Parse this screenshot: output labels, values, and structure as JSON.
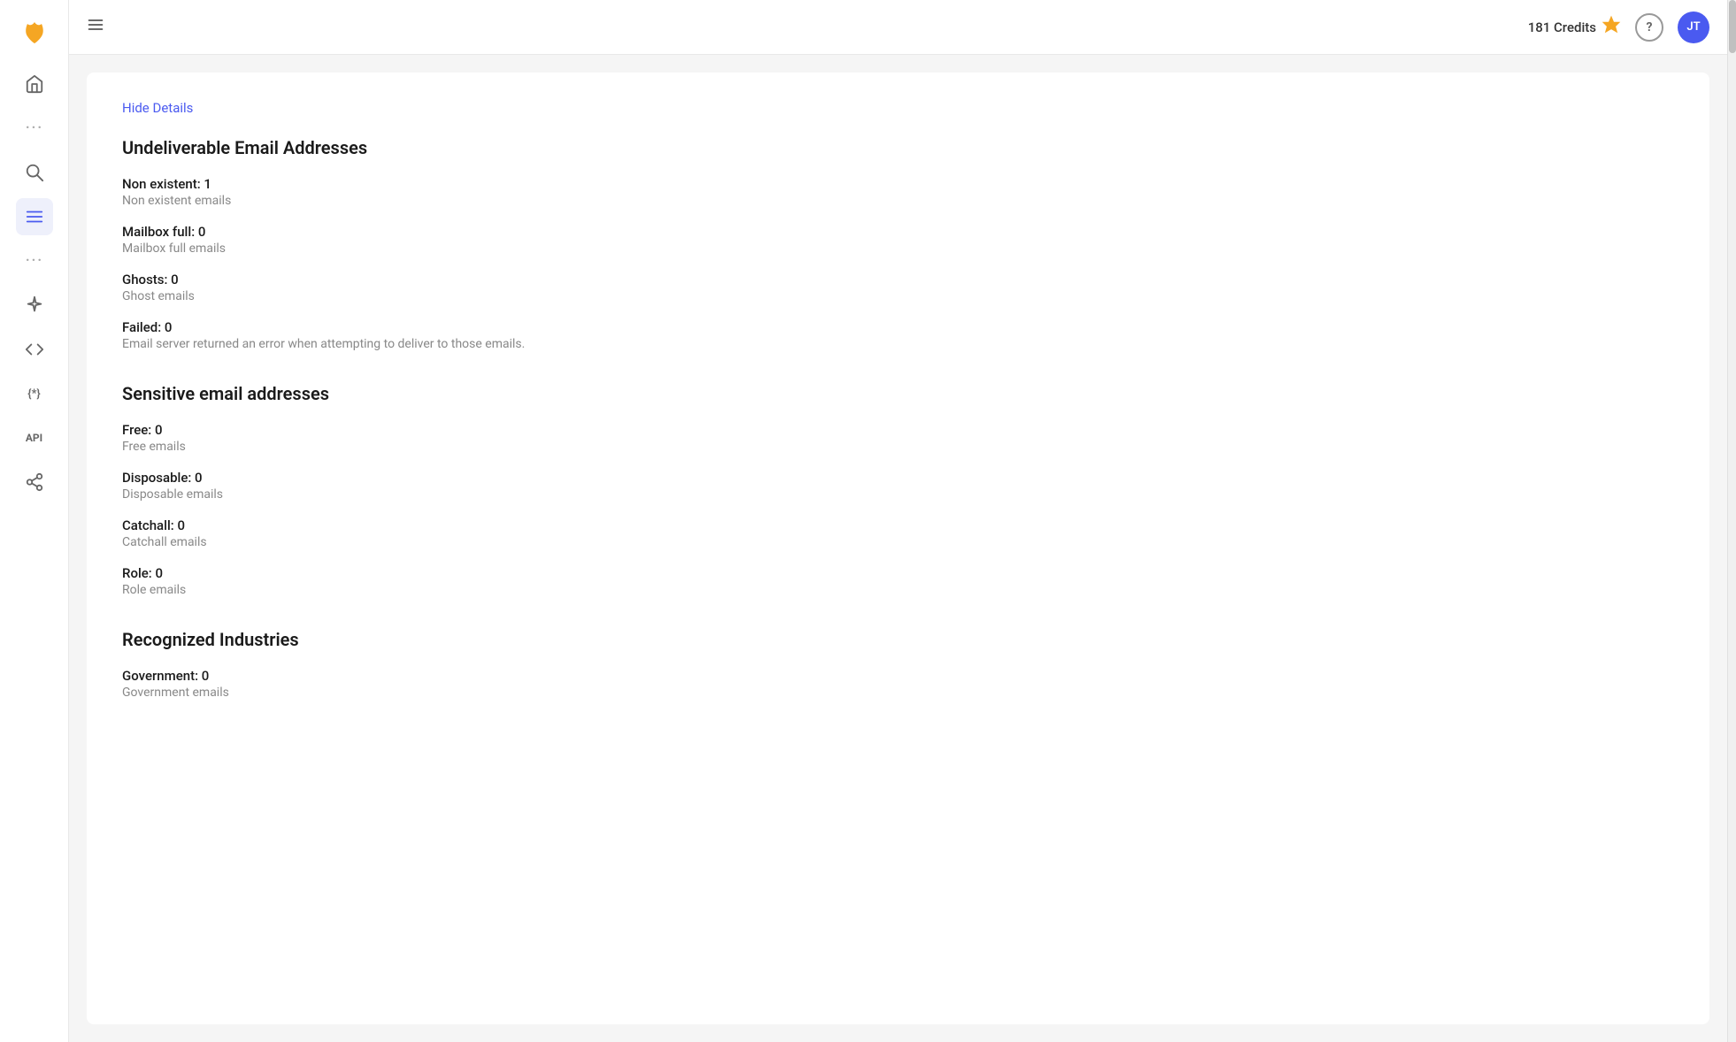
{
  "header": {
    "menu_icon": "☰",
    "credits_label": "181 Credits",
    "credits_star": "★",
    "help_label": "?",
    "avatar_label": "JT"
  },
  "sidebar": {
    "logo_symbol": "✦",
    "nav_items": [
      {
        "id": "home",
        "icon": "⌂",
        "label": "Home",
        "active": false
      },
      {
        "id": "dots1",
        "icon": "···",
        "label": "More",
        "active": false
      },
      {
        "id": "search",
        "icon": "⊕",
        "label": "Search",
        "active": false
      },
      {
        "id": "list",
        "icon": "≡",
        "label": "List",
        "active": true
      },
      {
        "id": "dots2",
        "icon": "···",
        "label": "More2",
        "active": false
      },
      {
        "id": "sparkle",
        "icon": "✳",
        "label": "Sparkle",
        "active": false
      },
      {
        "id": "code",
        "icon": "</>",
        "label": "Code",
        "active": false
      },
      {
        "id": "regex",
        "icon": "{*}",
        "label": "Regex",
        "active": false
      },
      {
        "id": "api",
        "icon": "API",
        "label": "API",
        "active": false
      },
      {
        "id": "webhook",
        "icon": "⑂",
        "label": "Webhook",
        "active": false
      }
    ]
  },
  "content": {
    "hide_details_label": "Hide Details",
    "sections": [
      {
        "id": "undeliverable",
        "title": "Undeliverable Email Addresses",
        "stats": [
          {
            "label": "Non existent: 1",
            "desc": "Non existent emails"
          },
          {
            "label": "Mailbox full: 0",
            "desc": "Mailbox full emails"
          },
          {
            "label": "Ghosts: 0",
            "desc": "Ghost emails"
          },
          {
            "label": "Failed: 0",
            "desc": "Email server returned an error when attempting to deliver to those emails."
          }
        ]
      },
      {
        "id": "sensitive",
        "title": "Sensitive email addresses",
        "stats": [
          {
            "label": "Free: 0",
            "desc": "Free emails"
          },
          {
            "label": "Disposable: 0",
            "desc": "Disposable emails"
          },
          {
            "label": "Catchall: 0",
            "desc": "Catchall emails"
          },
          {
            "label": "Role: 0",
            "desc": "Role emails"
          }
        ]
      },
      {
        "id": "industries",
        "title": "Recognized Industries",
        "stats": [
          {
            "label": "Government: 0",
            "desc": "Government emails"
          }
        ]
      }
    ]
  }
}
